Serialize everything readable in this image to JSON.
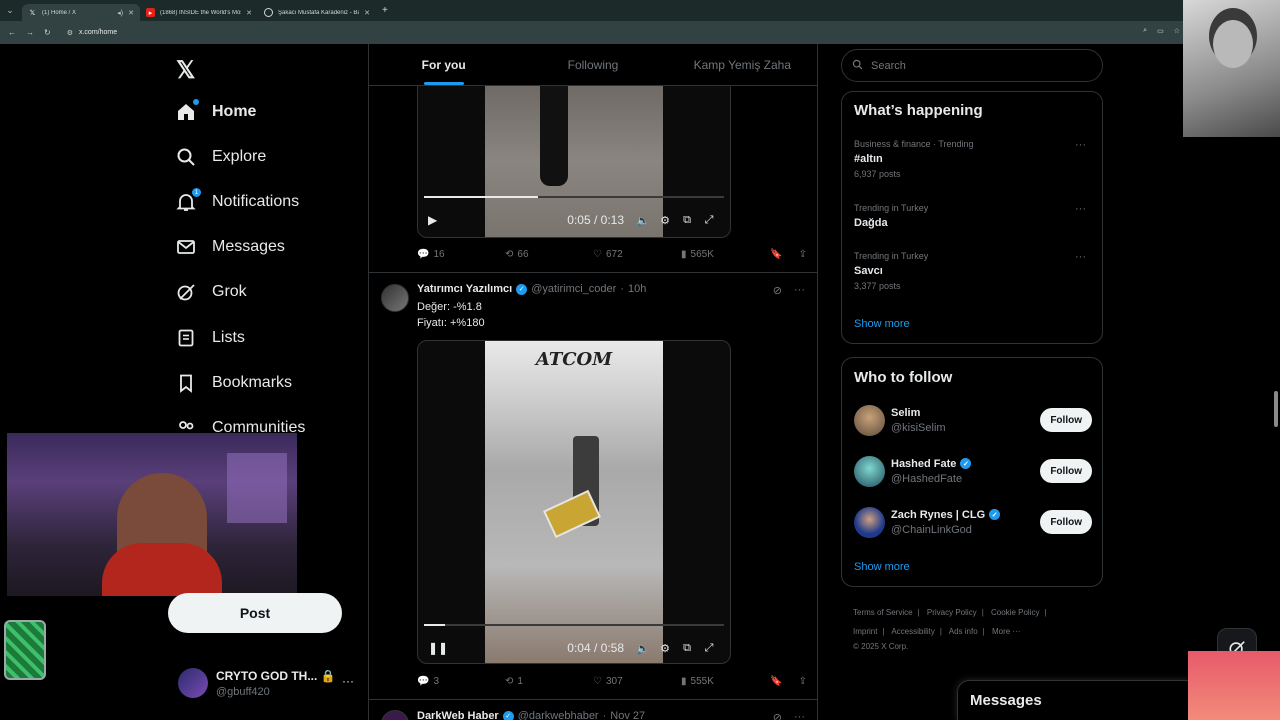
{
  "browser": {
    "tabs": [
      {
        "title": "(1) Home / X",
        "favicon": "X"
      },
      {
        "title": "(1868) INSIDE the World's Most",
        "favicon": "▶"
      },
      {
        "title": "Şakacı Mustafa Karadeniz - Bal",
        "favicon": "G"
      }
    ],
    "url": "x.com/home"
  },
  "nav": {
    "items": [
      {
        "label": "Home",
        "icon": "home-icon"
      },
      {
        "label": "Explore",
        "icon": "search-icon"
      },
      {
        "label": "Notifications",
        "icon": "bell-icon",
        "badge": "1"
      },
      {
        "label": "Messages",
        "icon": "mail-icon"
      },
      {
        "label": "Grok",
        "icon": "grok-icon"
      },
      {
        "label": "Lists",
        "icon": "list-icon"
      },
      {
        "label": "Bookmarks",
        "icon": "bookmark-icon"
      },
      {
        "label": "Communities",
        "icon": "people-icon"
      }
    ],
    "post_label": "Post",
    "profile": {
      "name": "CRYTO GOD TH...",
      "handle": "@gbuff420"
    }
  },
  "timeline": {
    "tabs": [
      "For you",
      "Following",
      "Kamp Yemiş Zaha"
    ],
    "video1": {
      "time": "0:05 / 0:13",
      "progress": 0.38
    },
    "stats1": {
      "replies": "16",
      "reposts": "66",
      "likes": "672",
      "views": "565K"
    },
    "tweet2": {
      "name": "Yatırımcı Yazılımcı",
      "handle": "@yatirimci_coder",
      "age": "10h",
      "line1": "Değer: -%1.8",
      "line2": "Fiyatı: +%180",
      "overlay": "ATCOM"
    },
    "video2": {
      "time": "0:04 / 0:58",
      "progress": 0.07
    },
    "stats2": {
      "replies": "3",
      "reposts": "1",
      "likes": "307",
      "views": "555K"
    },
    "tweet3": {
      "name": "DarkWeb Haber",
      "handle": "@darkwebhaber",
      "age": "Nov 27"
    }
  },
  "right": {
    "search_placeholder": "Search",
    "happening_title": "What’s happening",
    "trends": [
      {
        "category": "Business & finance · Trending",
        "topic": "#altın",
        "count": "6,937 posts"
      },
      {
        "category": "Trending in Turkey",
        "topic": "Dağda",
        "count": ""
      },
      {
        "category": "Trending in Turkey",
        "topic": "Savcı",
        "count": "3,377 posts"
      }
    ],
    "show_more": "Show more",
    "wtf_title": "Who to follow",
    "follow": [
      {
        "name": "Selim",
        "handle": "@kisiSelim",
        "verified": false
      },
      {
        "name": "Hashed Fate",
        "handle": "@HashedFate",
        "verified": true
      },
      {
        "name": "Zach Rynes | CLG",
        "handle": "@ChainLinkGod",
        "verified": true
      }
    ],
    "follow_label": "Follow",
    "footer_row1": [
      "Terms of Service",
      "Privacy Policy",
      "Cookie Policy"
    ],
    "footer_row2": [
      "Imprint",
      "Accessibility",
      "Ads info",
      "More ···"
    ],
    "copyright": "© 2025 X Corp."
  },
  "messages_drawer": "Messages",
  "colors": {
    "accent": "#1d9bf0",
    "background": "#000000",
    "border": "#2f3336",
    "muted": "#71767b"
  }
}
